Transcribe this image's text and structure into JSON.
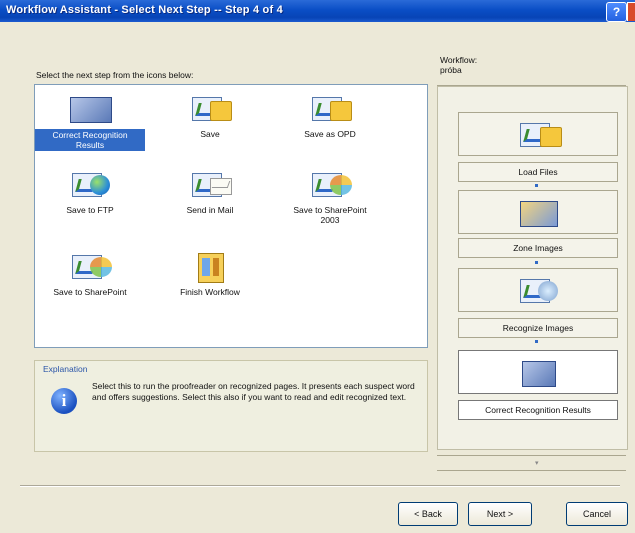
{
  "window": {
    "title": "Workflow Assistant - Select Next Step -- Step 4 of 4",
    "help_glyph": "?"
  },
  "instruction": "Select the next step from the icons below:",
  "tasks": [
    {
      "label": "Correct Recognition Results",
      "icon": "proofread-icon",
      "selected": true
    },
    {
      "label": "Save",
      "icon": "save-folder-icon",
      "selected": false
    },
    {
      "label": "Save as OPD",
      "icon": "save-opd-icon",
      "selected": false
    },
    {
      "label": "Save to FTP",
      "icon": "ftp-globe-icon",
      "selected": false
    },
    {
      "label": "Send in Mail",
      "icon": "mail-icon",
      "selected": false
    },
    {
      "label": "Save to SharePoint 2003",
      "icon": "sharepoint-icon",
      "selected": false
    },
    {
      "label": "Save to SharePoint",
      "icon": "sharepoint-icon",
      "selected": false
    },
    {
      "label": "Finish Workflow",
      "icon": "finish-icon",
      "selected": false
    }
  ],
  "explanation": {
    "label": "Explanation",
    "icon": "info-icon",
    "text": "Select this to run the proofreader on recognized pages. It presents each suspect word and offers suggestions. Select this also if you want to read and edit recognized text."
  },
  "workflow": {
    "label": "Workflow:",
    "name": "próba",
    "steps": [
      {
        "label": "Load Files",
        "icon": "load-files-icon"
      },
      {
        "label": "Zone Images",
        "icon": "zone-images-icon"
      },
      {
        "label": "Recognize Images",
        "icon": "recognize-images-icon"
      },
      {
        "label": "Correct Recognition Results",
        "icon": "correct-results-icon",
        "active": true
      }
    ]
  },
  "buttons": {
    "back": "< Back",
    "next": "Next >",
    "cancel": "Cancel"
  },
  "colors": {
    "title_blue": "#0a4ec5",
    "selection": "#316ac5",
    "dialog_bg": "#ece9d8"
  }
}
